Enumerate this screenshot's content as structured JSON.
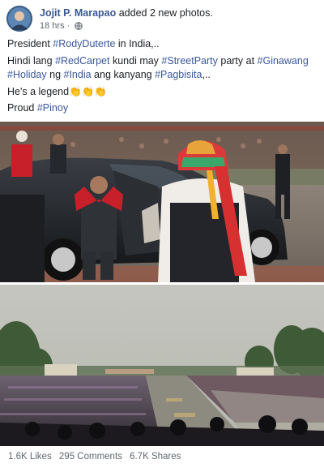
{
  "post": {
    "author": "Jojit P. Marapao",
    "action": "added 2 new photos.",
    "time": "18 hrs",
    "separator": "·",
    "privacy_icon": "globe-icon",
    "line1": {
      "a": "President ",
      "b": "#RodyDuterte",
      "c": " in India,.."
    },
    "line2": {
      "a": "Hindi lang ",
      "b": "#RedCarpet",
      "c": " kundi may ",
      "d": "#StreetParty",
      "e": " party at ",
      "f": "#Ginawang"
    },
    "line3": {
      "a": "#Holiday",
      "b": " ng ",
      "c": "#India",
      "d": " ang kanyang ",
      "e": "#Pagbisita",
      "f": ",.."
    },
    "line4": {
      "a": "He's a legend",
      "emoji": "👏👏👏"
    },
    "line5": {
      "a": "Proud ",
      "b": "#Pinoy"
    }
  },
  "stats": {
    "likes": "1.6K Likes",
    "comments": "295 Comments",
    "shares": "6.7K Shares"
  },
  "colors": {
    "link": "#385898",
    "text": "#1c1e21",
    "meta": "#606770"
  }
}
